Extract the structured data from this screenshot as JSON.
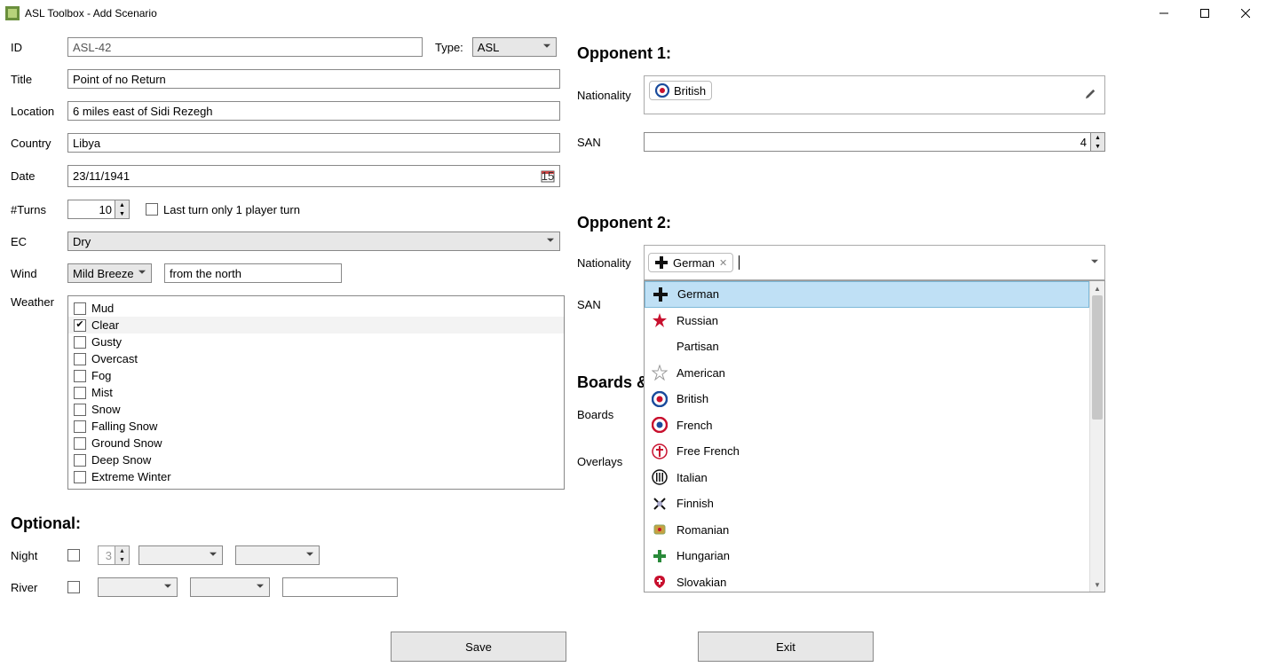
{
  "window": {
    "title": "ASL Toolbox - Add Scenario"
  },
  "type": {
    "label": "Type:",
    "value": "ASL"
  },
  "fields": {
    "id": {
      "label": "ID",
      "value": "ASL-42"
    },
    "title": {
      "label": "Title",
      "value": "Point of no Return"
    },
    "location": {
      "label": "Location",
      "value": "6 miles east of Sidi Rezegh"
    },
    "country": {
      "label": "Country",
      "value": "Libya"
    },
    "date": {
      "label": "Date",
      "value": "23/11/1941",
      "day_badge": "15"
    },
    "turns": {
      "label": "#Turns",
      "value": "10",
      "lastTurnLabel": "Last turn only 1 player turn"
    },
    "ec": {
      "label": "EC",
      "value": "Dry"
    },
    "wind": {
      "label": "Wind",
      "value": "Mild Breeze",
      "direction": "from the north"
    },
    "weather": {
      "label": "Weather",
      "items": [
        {
          "name": "Mud",
          "checked": false
        },
        {
          "name": "Clear",
          "checked": true
        },
        {
          "name": "Gusty",
          "checked": false
        },
        {
          "name": "Overcast",
          "checked": false
        },
        {
          "name": "Fog",
          "checked": false
        },
        {
          "name": "Mist",
          "checked": false
        },
        {
          "name": "Snow",
          "checked": false
        },
        {
          "name": "Falling Snow",
          "checked": false
        },
        {
          "name": "Ground Snow",
          "checked": false
        },
        {
          "name": "Deep Snow",
          "checked": false
        },
        {
          "name": "Extreme Winter",
          "checked": false
        }
      ]
    }
  },
  "optional": {
    "heading": "Optional:",
    "night": {
      "label": "Night",
      "value": "3"
    },
    "river": {
      "label": "River"
    }
  },
  "opponent1": {
    "heading": "Opponent 1:",
    "natLabel": "Nationality",
    "chip": "British",
    "sanLabel": "SAN",
    "sanValue": "4"
  },
  "opponent2": {
    "heading": "Opponent 2:",
    "natLabel": "Nationality",
    "chip": "German",
    "sanLabel": "SAN",
    "dropdown": [
      "German",
      "Russian",
      "Partisan",
      "American",
      "British",
      "French",
      "Free French",
      "Italian",
      "Finnish",
      "Romanian",
      "Hungarian",
      "Slovakian"
    ]
  },
  "boards": {
    "heading": "Boards &",
    "boardsLabel": "Boards",
    "overlaysLabel": "Overlays"
  },
  "buttons": {
    "save": "Save",
    "exit": "Exit"
  }
}
